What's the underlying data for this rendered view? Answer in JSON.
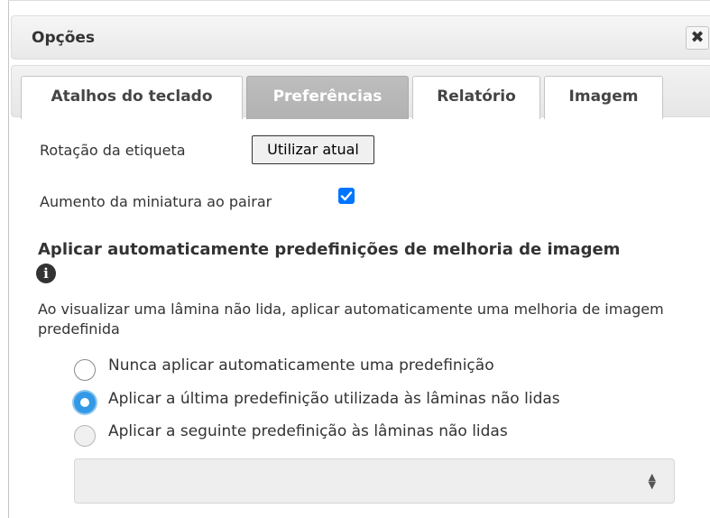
{
  "dialog": {
    "title": "Opções",
    "close_icon": "close-icon",
    "close_glyph": "✖"
  },
  "tabs": [
    {
      "label": "Atalhos do teclado",
      "active": false
    },
    {
      "label": "Preferências",
      "active": true
    },
    {
      "label": "Relatório",
      "active": false
    },
    {
      "label": "Imagem",
      "active": false
    }
  ],
  "preferences": {
    "label_rotation": {
      "label": "Rotação da etiqueta",
      "button": "Utilizar atual"
    },
    "thumbnail_zoom": {
      "label": "Aumento da miniatura ao pairar",
      "checked": true
    },
    "auto_enhance": {
      "heading": "Aplicar automaticamente predefinições de melhoria de imagem",
      "info_icon": "info-icon",
      "description": "Ao visualizar uma lâmina não lida, aplicar automaticamente uma melhoria de imagem predefinida",
      "options": [
        {
          "label": "Nunca aplicar automaticamente uma predefinição",
          "checked": false
        },
        {
          "label": "Aplicar a última predefinição utilizada às lâminas não lidas",
          "checked": true
        },
        {
          "label": "Aplicar a seguinte predefinição às lâminas não lidas",
          "checked": false
        }
      ],
      "preset_select_value": ""
    }
  },
  "colors": {
    "accent": "#3399e6",
    "checkbox": "#0075ff",
    "active_tab": "#b8b8b8"
  }
}
